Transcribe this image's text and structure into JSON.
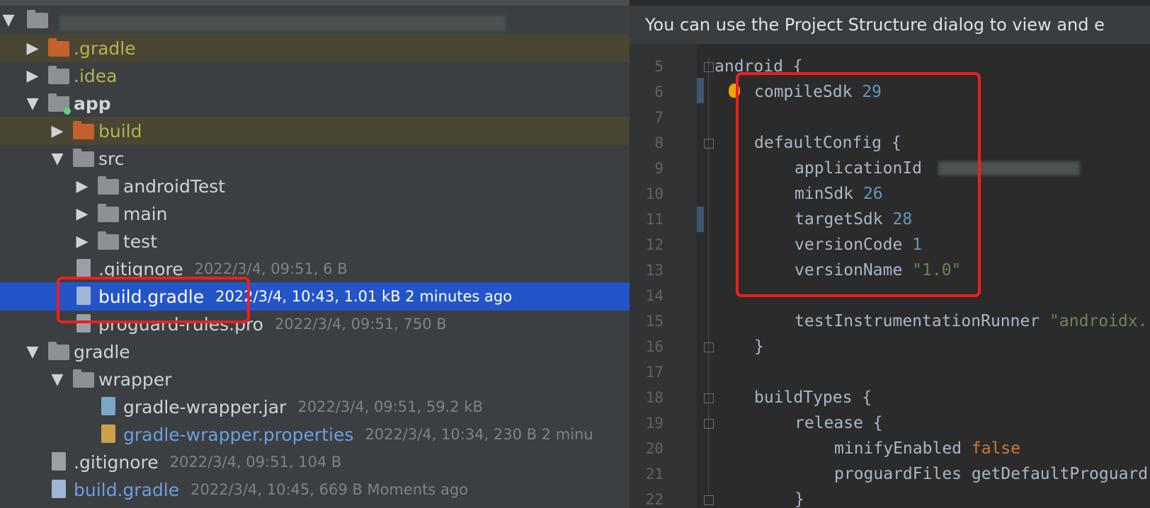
{
  "tree": {
    "rows": [
      {
        "label": "",
        "meta": ""
      },
      {
        "label": ".gradle",
        "meta": ""
      },
      {
        "label": ".idea",
        "meta": ""
      },
      {
        "label": "app",
        "meta": ""
      },
      {
        "label": "build",
        "meta": ""
      },
      {
        "label": "src",
        "meta": ""
      },
      {
        "label": "androidTest",
        "meta": ""
      },
      {
        "label": "main",
        "meta": ""
      },
      {
        "label": "test",
        "meta": ""
      },
      {
        "label": ".gitignore",
        "meta": "2022/3/4, 09:51, 6 B"
      },
      {
        "label": "build.gradle",
        "meta": "2022/3/4, 10:43, 1.01 kB 2 minutes ago"
      },
      {
        "label": "proguard-rules.pro",
        "meta": "2022/3/4, 09:51, 750 B"
      },
      {
        "label": "gradle",
        "meta": ""
      },
      {
        "label": "wrapper",
        "meta": ""
      },
      {
        "label": "gradle-wrapper.jar",
        "meta": "2022/3/4, 09:51, 59.2 kB"
      },
      {
        "label": "gradle-wrapper.properties",
        "meta": "2022/3/4, 10:34, 230 B 2 minu"
      },
      {
        "label": ".gitignore",
        "meta": "2022/3/4, 09:51, 104 B"
      },
      {
        "label": "build.gradle",
        "meta": "2022/3/4, 10:45, 669 B Moments ago"
      }
    ]
  },
  "editor": {
    "banner": "You can use the Project Structure dialog to view and e",
    "lines": [
      {
        "n": "5",
        "a": "android ",
        "b": "{"
      },
      {
        "n": "6",
        "a": "compileSdk ",
        "b": "29"
      },
      {
        "n": "7",
        "a": "",
        "b": ""
      },
      {
        "n": "8",
        "a": "defaultConfig ",
        "b": "{"
      },
      {
        "n": "9",
        "a": "applicationId ",
        "b": ""
      },
      {
        "n": "10",
        "a": "minSdk ",
        "b": "26"
      },
      {
        "n": "11",
        "a": "targetSdk ",
        "b": "28"
      },
      {
        "n": "12",
        "a": "versionCode ",
        "b": "1"
      },
      {
        "n": "13",
        "a": "versionName ",
        "b": "\"1.0\""
      },
      {
        "n": "14",
        "a": "",
        "b": ""
      },
      {
        "n": "15",
        "a": "testInstrumentationRunner ",
        "b": "\"androidx."
      },
      {
        "n": "16",
        "a": "}",
        "b": ""
      },
      {
        "n": "17",
        "a": "",
        "b": ""
      },
      {
        "n": "18",
        "a": "buildTypes ",
        "b": "{"
      },
      {
        "n": "19",
        "a": "release ",
        "b": "{"
      },
      {
        "n": "20",
        "a": "minifyEnabled ",
        "b": "false"
      },
      {
        "n": "21",
        "a": "proguardFiles getDefaultProguard",
        "b": ""
      },
      {
        "n": "22",
        "a": "}",
        "b": ""
      }
    ]
  }
}
